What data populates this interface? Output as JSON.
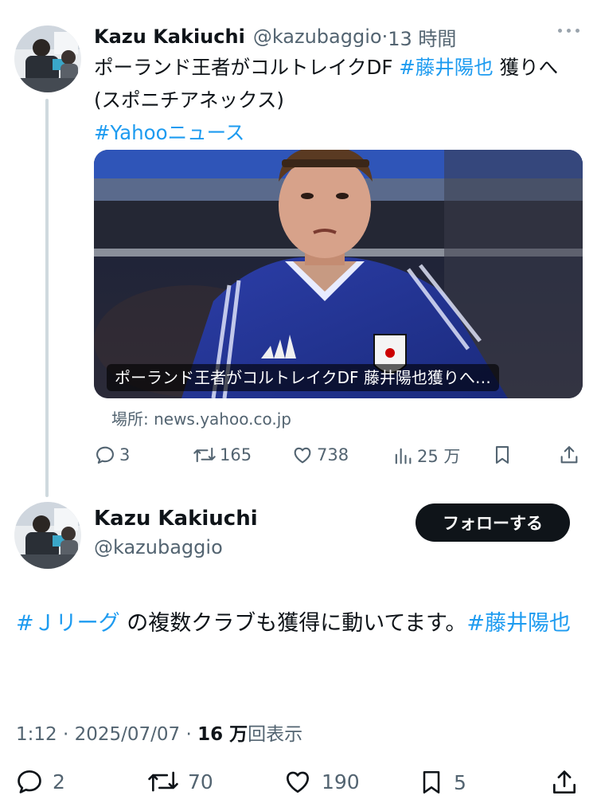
{
  "tweet1": {
    "author_name": "Kazu Kakiuchi",
    "author_handle": "@kazubaggio",
    "separator": " · ",
    "time": "13 時間",
    "text_part1": "ポーランド王者がコルトレイクDF ",
    "hashtag1": "#藤井陽也",
    "text_part2": " 獲りへ(スポニチアネックス)",
    "hashtag2": "#Yahooニュース",
    "card_caption": "ポーランド王者がコルトレイクDF 藤井陽也獲りへ…",
    "card_source": "場所: news.yahoo.co.jp",
    "replies": "3",
    "retweets": "165",
    "likes": "738",
    "views": "25 万"
  },
  "tweet2": {
    "author_name": "Kazu Kakiuchi",
    "author_handle": "@kazubaggio",
    "follow_label": "フォローする",
    "hashtag1": "#Ｊリーグ",
    "text_part1": " の複数クラブも獲得に動いてます。",
    "hashtag2": "#藤井陽也",
    "time": "1:12",
    "date": "2025/07/07",
    "views_count": "16 万",
    "views_label": "回表示",
    "replies": "2",
    "retweets": "70",
    "likes": "190",
    "bookmarks": "5"
  },
  "icons": [
    "more-icon",
    "reply-icon",
    "retweet-icon",
    "like-icon",
    "views-icon",
    "bookmark-icon",
    "share-icon"
  ],
  "colors": {
    "link": "#1d9bf0",
    "secondary_text": "#536471",
    "primary_text": "#0f1419",
    "follow_button": "#0f1419"
  }
}
